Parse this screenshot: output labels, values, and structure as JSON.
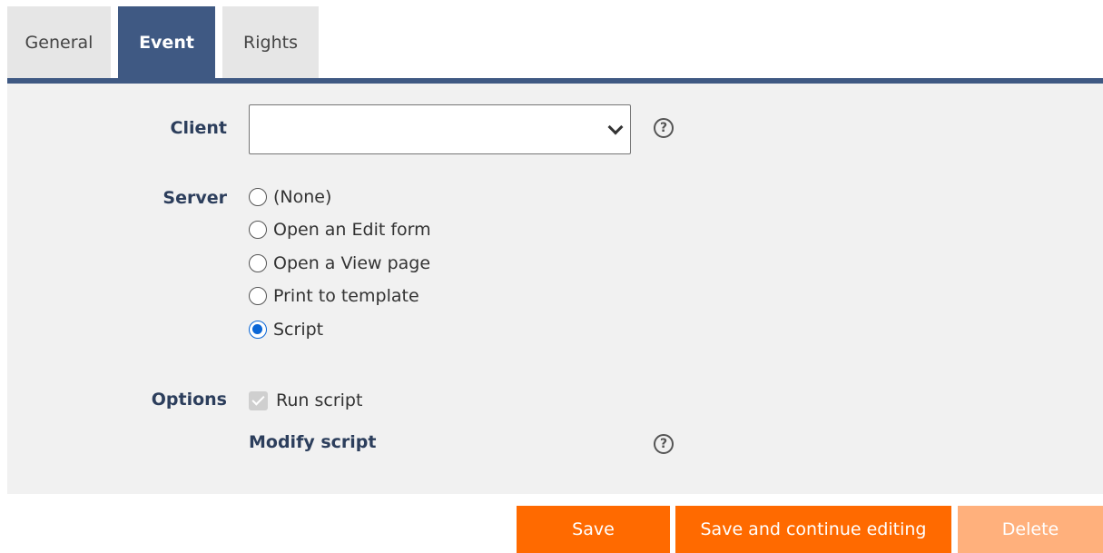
{
  "tabs": [
    {
      "label": "General",
      "active": false
    },
    {
      "label": "Event",
      "active": true
    },
    {
      "label": "Rights",
      "active": false
    }
  ],
  "form": {
    "client_label": "Client",
    "client_value": "",
    "server_label": "Server",
    "server_options": [
      "(None)",
      "Open an Edit form",
      "Open a View page",
      "Print to template",
      "Script"
    ],
    "server_selected": "Script",
    "options_label": "Options",
    "run_script_label": "Run script",
    "run_script_checked": true,
    "run_script_disabled": true,
    "modify_script_label": "Modify script",
    "help_glyph": "?"
  },
  "buttons": {
    "save": "Save",
    "save_continue": "Save and continue editing",
    "delete": "Delete"
  },
  "colors": {
    "accent": "#3f5983",
    "primary_button": "#ff6a00",
    "disabled_button": "#ffb07c",
    "radio_checked": "#0a66d6"
  }
}
